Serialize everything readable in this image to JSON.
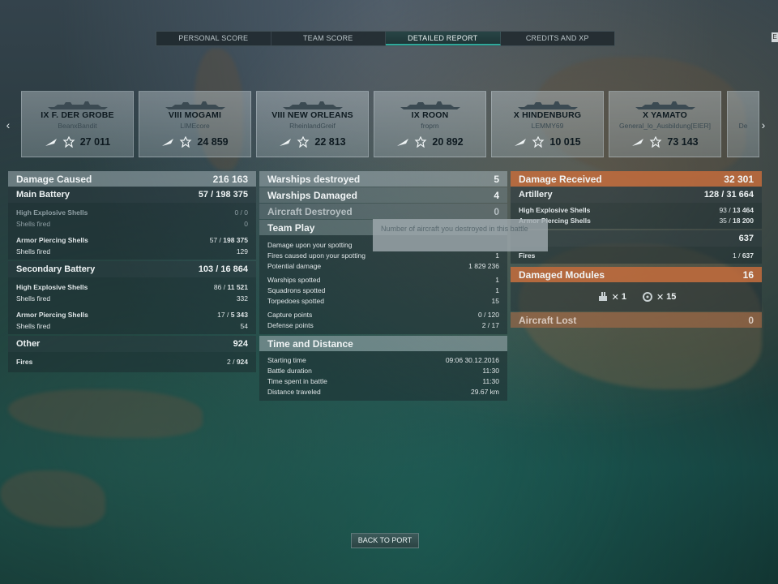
{
  "tabs": [
    {
      "label": "PERSONAL SCORE",
      "active": false
    },
    {
      "label": "TEAM SCORE",
      "active": false
    },
    {
      "label": "DETAILED REPORT",
      "active": true
    },
    {
      "label": "CREDITS AND XP",
      "active": false
    }
  ],
  "carousel": {
    "prev_icon": "chevron-left-icon",
    "next_icon": "chevron-right-icon",
    "ships": [
      {
        "name": "IX F. DER GROBE",
        "player": "BeanxBandit",
        "score": "27 011"
      },
      {
        "name": "VIII MOGAMI",
        "player": "LIMEcore",
        "score": "24 859"
      },
      {
        "name": "VIII NEW ORLEANS",
        "player": "RheinlandGreif",
        "score": "22 813"
      },
      {
        "name": "IX ROON",
        "player": "froprn",
        "score": "20 892"
      },
      {
        "name": "X HINDENBURG",
        "player": "LEMMY69",
        "score": "10 015"
      },
      {
        "name": "X YAMATO",
        "player": "General_lo_Ausbildung[EIER]",
        "score": "73 143"
      },
      {
        "name": "",
        "player": "De",
        "score": ""
      }
    ]
  },
  "damage_caused": {
    "title": "Damage Caused",
    "value": "216 163",
    "main_battery": {
      "title": "Main Battery",
      "hit": "57",
      "total": "198 375"
    },
    "he_shells": {
      "label": "High Explosive Shells",
      "value": "0 / 0",
      "fired_label": "Shells fired",
      "fired": "0"
    },
    "ap_shells": {
      "label": "Armor Piercing Shells",
      "hit": "57",
      "total": "198 375",
      "fired_label": "Shells fired",
      "fired": "129"
    },
    "secondary": {
      "title": "Secondary Battery",
      "hit": "103",
      "total": "16 864"
    },
    "sec_he": {
      "label": "High Explosive Shells",
      "hit": "86",
      "total": "11 521",
      "fired_label": "Shells fired",
      "fired": "332"
    },
    "sec_ap": {
      "label": "Armor Piercing Shells",
      "hit": "17",
      "total": "5 343",
      "fired_label": "Shells fired",
      "fired": "54"
    },
    "other": {
      "title": "Other",
      "value": "924",
      "fires_label": "Fires",
      "fires_hit": "2",
      "fires_total": "924"
    }
  },
  "middle": {
    "warships_destroyed": {
      "label": "Warships destroyed",
      "value": "5"
    },
    "warships_damaged": {
      "label": "Warships Damaged",
      "value": "4"
    },
    "aircraft_destroyed": {
      "label": "Aircraft Destroyed",
      "value": "0"
    },
    "team_play": {
      "title": "Team Play",
      "rows": [
        {
          "label": "Damage upon your spotting",
          "value": ""
        },
        {
          "label": "Fires caused upon your spotting",
          "value": "1"
        },
        {
          "label": "Potential damage",
          "value": "1 829 236"
        },
        {
          "label": "Warships spotted",
          "value": "1"
        },
        {
          "label": "Squadrons spotted",
          "value": "1"
        },
        {
          "label": "Torpedoes spotted",
          "value": "15"
        },
        {
          "label": "Capture points",
          "value": "0 / 120"
        },
        {
          "label": "Defense points",
          "value": "2 / 17"
        }
      ]
    },
    "time_distance": {
      "title": "Time and Distance",
      "rows": [
        {
          "label": "Starting time",
          "value": "09:06  30.12.2016"
        },
        {
          "label": "Battle duration",
          "value": "11:30"
        },
        {
          "label": "Time spent in battle",
          "value": "11:30"
        },
        {
          "label": "Distance traveled",
          "value": "29.67 km"
        }
      ]
    }
  },
  "tooltip": {
    "text": "Number of aircraft you destroyed in this battle"
  },
  "damage_received": {
    "title": "Damage Received",
    "value": "32 301",
    "artillery": {
      "title": "Artillery",
      "hit": "128",
      "total": "31 664"
    },
    "he": {
      "label": "High Explosive Shells",
      "hit": "93",
      "total": "13 464"
    },
    "ap": {
      "label": "Armor Piercing Shells",
      "hit": "35",
      "total": "18 200"
    },
    "fires_header_value": "637",
    "fires": {
      "label": "Fires",
      "hit": "1",
      "total": "637"
    }
  },
  "damaged_modules": {
    "title": "Damaged Modules",
    "value": "16",
    "modules": [
      {
        "icon": "gun-turret-icon",
        "count": "1"
      },
      {
        "icon": "engine-icon",
        "count": "15"
      }
    ]
  },
  "aircraft_lost": {
    "title": "Aircraft Lost",
    "value": "0"
  },
  "back_button": {
    "label": "BACK TO PORT"
  }
}
